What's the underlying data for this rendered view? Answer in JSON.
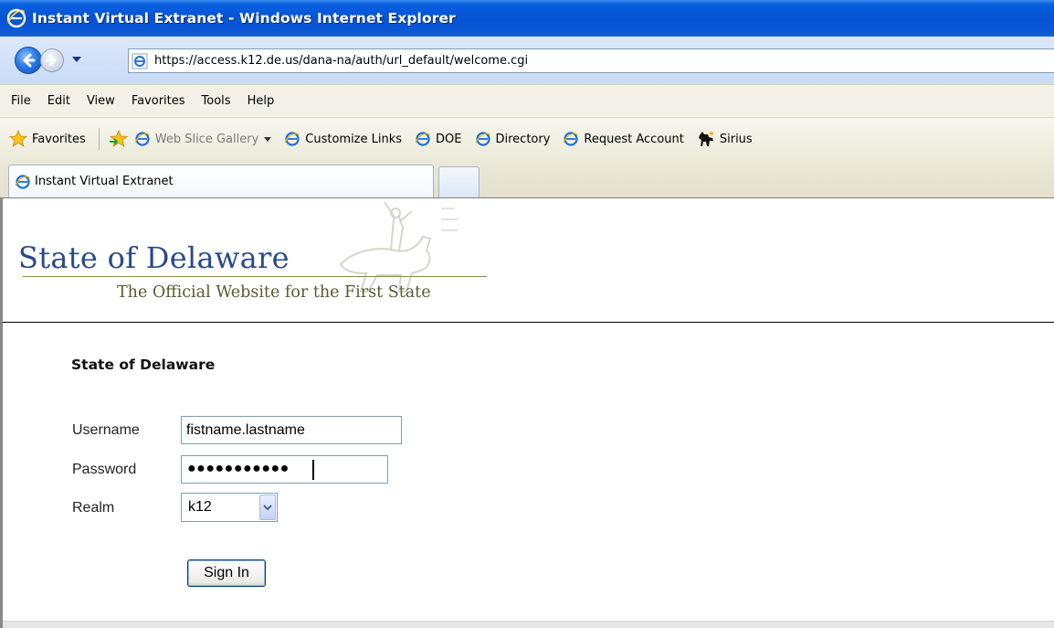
{
  "window": {
    "title": "Instant Virtual Extranet - Windows Internet Explorer"
  },
  "address_bar": {
    "url": "https://access.k12.de.us/dana-na/auth/url_default/welcome.cgi"
  },
  "menu": {
    "items": [
      "File",
      "Edit",
      "View",
      "Favorites",
      "Tools",
      "Help"
    ]
  },
  "favorites_bar": {
    "favorites_label": "Favorites",
    "items": [
      {
        "label": "Web Slice Gallery",
        "icon": "ie-page-icon",
        "dimmed": true
      },
      {
        "label": "Customize Links",
        "icon": "ie-page-icon"
      },
      {
        "label": "DOE",
        "icon": "ie-page-icon"
      },
      {
        "label": "Directory",
        "icon": "ie-page-icon"
      },
      {
        "label": "Request Account",
        "icon": "ie-page-icon"
      },
      {
        "label": "Sirius",
        "icon": "dog-icon"
      }
    ]
  },
  "tabs": {
    "active_label": "Instant Virtual Extranet"
  },
  "banner": {
    "title": "State of Delaware",
    "subtitle": "The Official Website for the First State"
  },
  "form": {
    "heading": "State of Delaware",
    "username_label": "Username",
    "username_value": "fistname.lastname",
    "password_label": "Password",
    "password_mask": "●●●●●●●●●●●",
    "realm_label": "Realm",
    "realm_value": "k12",
    "submit_label": "Sign In"
  },
  "colors": {
    "titlebar_blue": "#0454d4",
    "banner_title": "#284a8c",
    "banner_subtitle": "#5a5a33"
  }
}
